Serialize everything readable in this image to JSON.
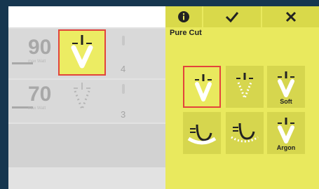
{
  "left": {
    "row1": {
      "watts": "90",
      "watts_label": "max Watt",
      "effect": "4"
    },
    "row2": {
      "watts": "70",
      "watts_label": "max Watt",
      "effect": "3"
    }
  },
  "right": {
    "title": "Pure Cut",
    "toolbar": {
      "info_icon": "info-icon",
      "confirm_icon": "checkmark-icon",
      "close_icon": "close-icon"
    },
    "modes": [
      {
        "icon": "pure-cut-icon",
        "label": ""
      },
      {
        "icon": "dotted-cut-icon",
        "label": ""
      },
      {
        "icon": "soft-cut-icon",
        "label": "Soft"
      },
      {
        "icon": "coag-cup-icon",
        "label": ""
      },
      {
        "icon": "dotted-coag-icon",
        "label": ""
      },
      {
        "icon": "argon-icon",
        "label": "Argon"
      }
    ]
  },
  "colors": {
    "accent": "#e9e95e",
    "selection": "#e2443b",
    "background": "#16364f"
  }
}
